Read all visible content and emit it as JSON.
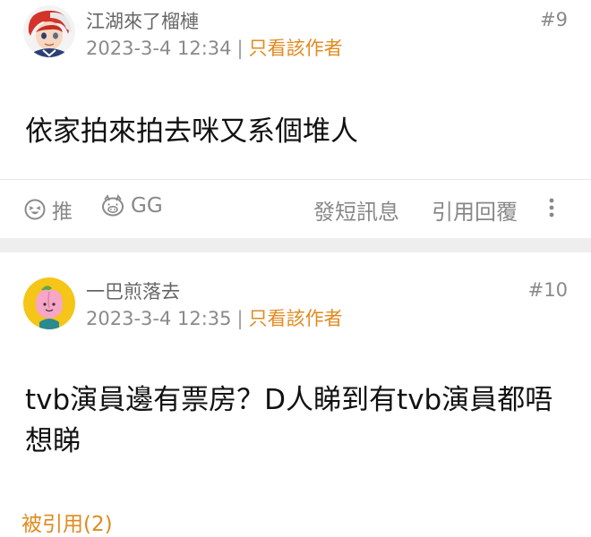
{
  "posts": [
    {
      "username": "江湖來了榴槤",
      "date": "2023-3-4 12:34",
      "separator": "|",
      "only_author": "只看該作者",
      "floor": "#9",
      "content": "依家拍來拍去咪又系個堆人",
      "actions": {
        "like": "推",
        "gg": "GG",
        "pm": "發短訊息",
        "quote": "引用回覆"
      }
    },
    {
      "username": "一巴煎落去",
      "date": "2023-3-4 12:35",
      "separator": "|",
      "only_author": "只看該作者",
      "floor": "#10",
      "content": "tvb演員邊有票房？D人睇到有tvb演員都唔想睇",
      "quoted_by": "被引用(2)"
    }
  ],
  "colors": {
    "accent": "#e08a1e",
    "meta": "#8a8a8a",
    "separator_bg": "#eeeeee"
  },
  "icons": {
    "like": "smiley-face-icon",
    "gg": "pig-face-icon",
    "more": "vertical-dots-icon"
  }
}
